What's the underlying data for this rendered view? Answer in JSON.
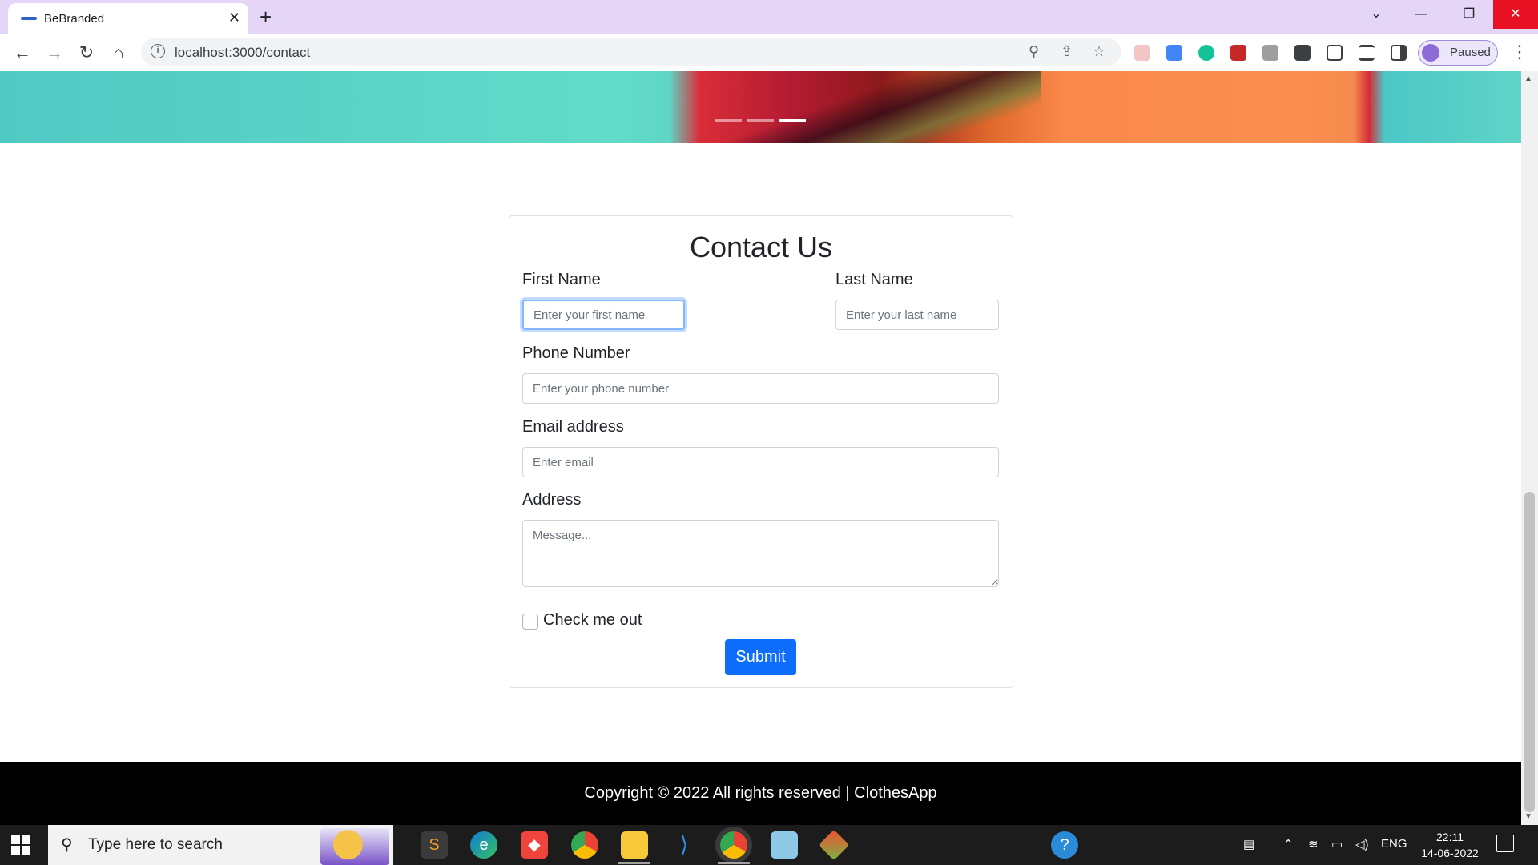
{
  "browser": {
    "tab_title": "BeBranded",
    "tab_close": "✕",
    "new_tab": "+",
    "url": "localhost:3000/contact",
    "profile_status": "Paused",
    "window_controls": {
      "dropdown": "⌄",
      "minimize": "—",
      "restore": "❐",
      "close": "✕"
    }
  },
  "hero": {
    "indicators": [
      {
        "active": false
      },
      {
        "active": false
      },
      {
        "active": true
      }
    ]
  },
  "contact_form": {
    "title": "Contact Us",
    "first_name": {
      "label": "First Name",
      "placeholder": "Enter your first name",
      "value": ""
    },
    "last_name": {
      "label": "Last Name",
      "placeholder": "Enter your last name",
      "value": ""
    },
    "phone": {
      "label": "Phone Number",
      "placeholder": "Enter your phone number",
      "value": ""
    },
    "email": {
      "label": "Email address",
      "placeholder": "Enter email",
      "value": ""
    },
    "address": {
      "label": "Address",
      "placeholder": "Message...",
      "value": ""
    },
    "checkbox": {
      "label": "Check me out",
      "checked": false
    },
    "submit_label": "Submit"
  },
  "footer": {
    "text": "Copyright © 2022 All rights reserved | ClothesApp"
  },
  "taskbar": {
    "search_placeholder": "Type here to search",
    "apps": [
      "sublime-text",
      "edge",
      "anydesk",
      "chrome",
      "file-explorer",
      "vscode",
      "chrome-profile",
      "notepad",
      "git"
    ],
    "language": "ENG",
    "time": "22:11",
    "date": "14-06-2022"
  },
  "colors": {
    "primary": "#0d6efd",
    "footer_bg": "#000000",
    "tabbar_bg": "#e5d5f7"
  }
}
